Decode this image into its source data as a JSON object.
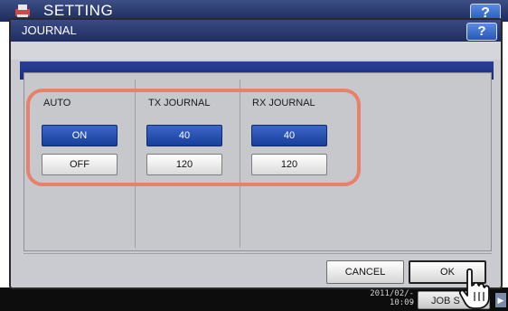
{
  "background": {
    "title": "SETTING",
    "help_label": "?",
    "date": "2011/02/--",
    "time": "10:09",
    "job_status_label": "JOB S"
  },
  "dialog": {
    "title": "JOURNAL",
    "help_label": "?",
    "columns": [
      {
        "label": "AUTO",
        "buttons": [
          {
            "label": "ON",
            "selected": true
          },
          {
            "label": "OFF",
            "selected": false
          }
        ]
      },
      {
        "label": "TX JOURNAL",
        "buttons": [
          {
            "label": "40",
            "selected": true
          },
          {
            "label": "120",
            "selected": false
          }
        ]
      },
      {
        "label": "RX JOURNAL",
        "buttons": [
          {
            "label": "40",
            "selected": true
          },
          {
            "label": "120",
            "selected": false
          }
        ]
      }
    ],
    "cancel_label": "CANCEL",
    "ok_label": "OK"
  },
  "colors": {
    "title_bar": "#1f2d61",
    "selected_button": "#1f4aa8",
    "highlight_outline": "#e9806a"
  },
  "icons": {
    "logo": "printer-icon",
    "pointer": "hand-pointer-icon"
  }
}
